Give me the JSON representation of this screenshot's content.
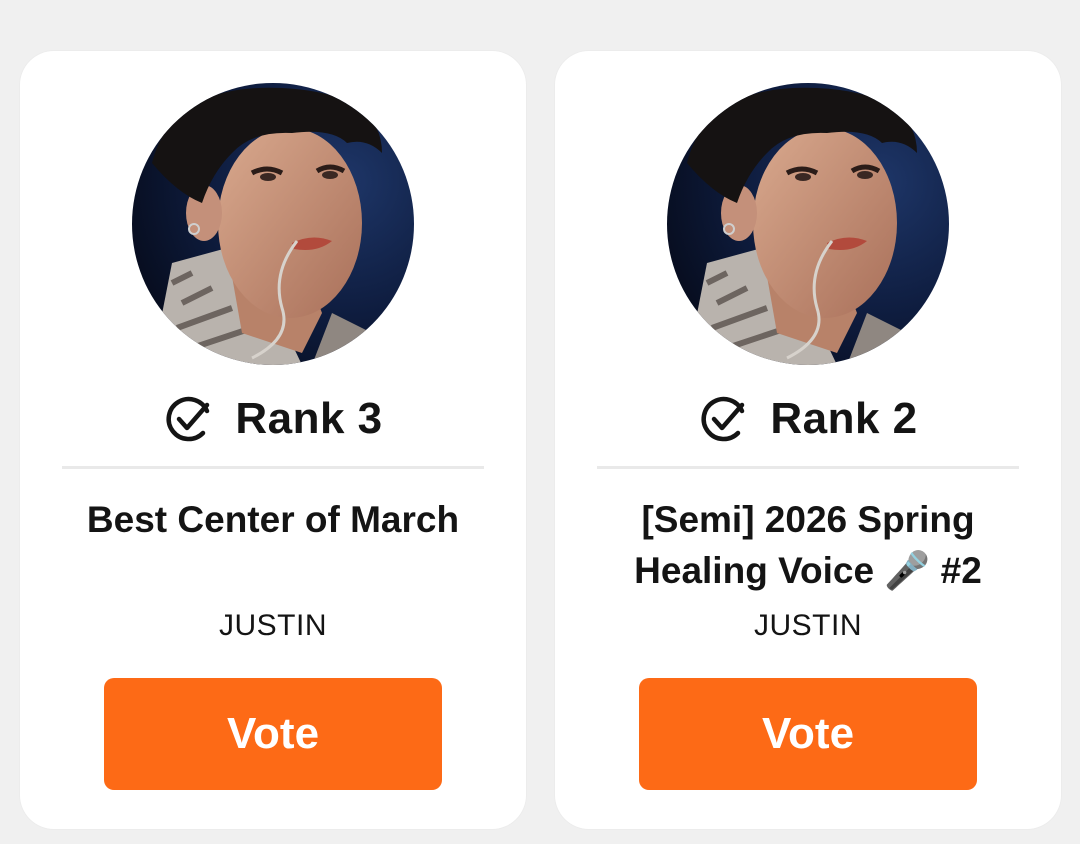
{
  "colors": {
    "accent": "#fd6a16",
    "page_background": "#f0f0f0",
    "card_background": "#ffffff",
    "text": "#141414"
  },
  "cards": [
    {
      "avatar": "profile-photo",
      "rank_icon": "check-circle-icon",
      "rank_label": "Rank 3",
      "title": "Best Center of March",
      "artist": "JUSTIN",
      "vote_label": "Vote"
    },
    {
      "avatar": "profile-photo",
      "rank_icon": "check-circle-icon",
      "rank_label": "Rank 2",
      "title": "[Semi] 2026 Spring Healing Voice 🎤 #2",
      "artist": "JUSTIN",
      "vote_label": "Vote"
    }
  ]
}
